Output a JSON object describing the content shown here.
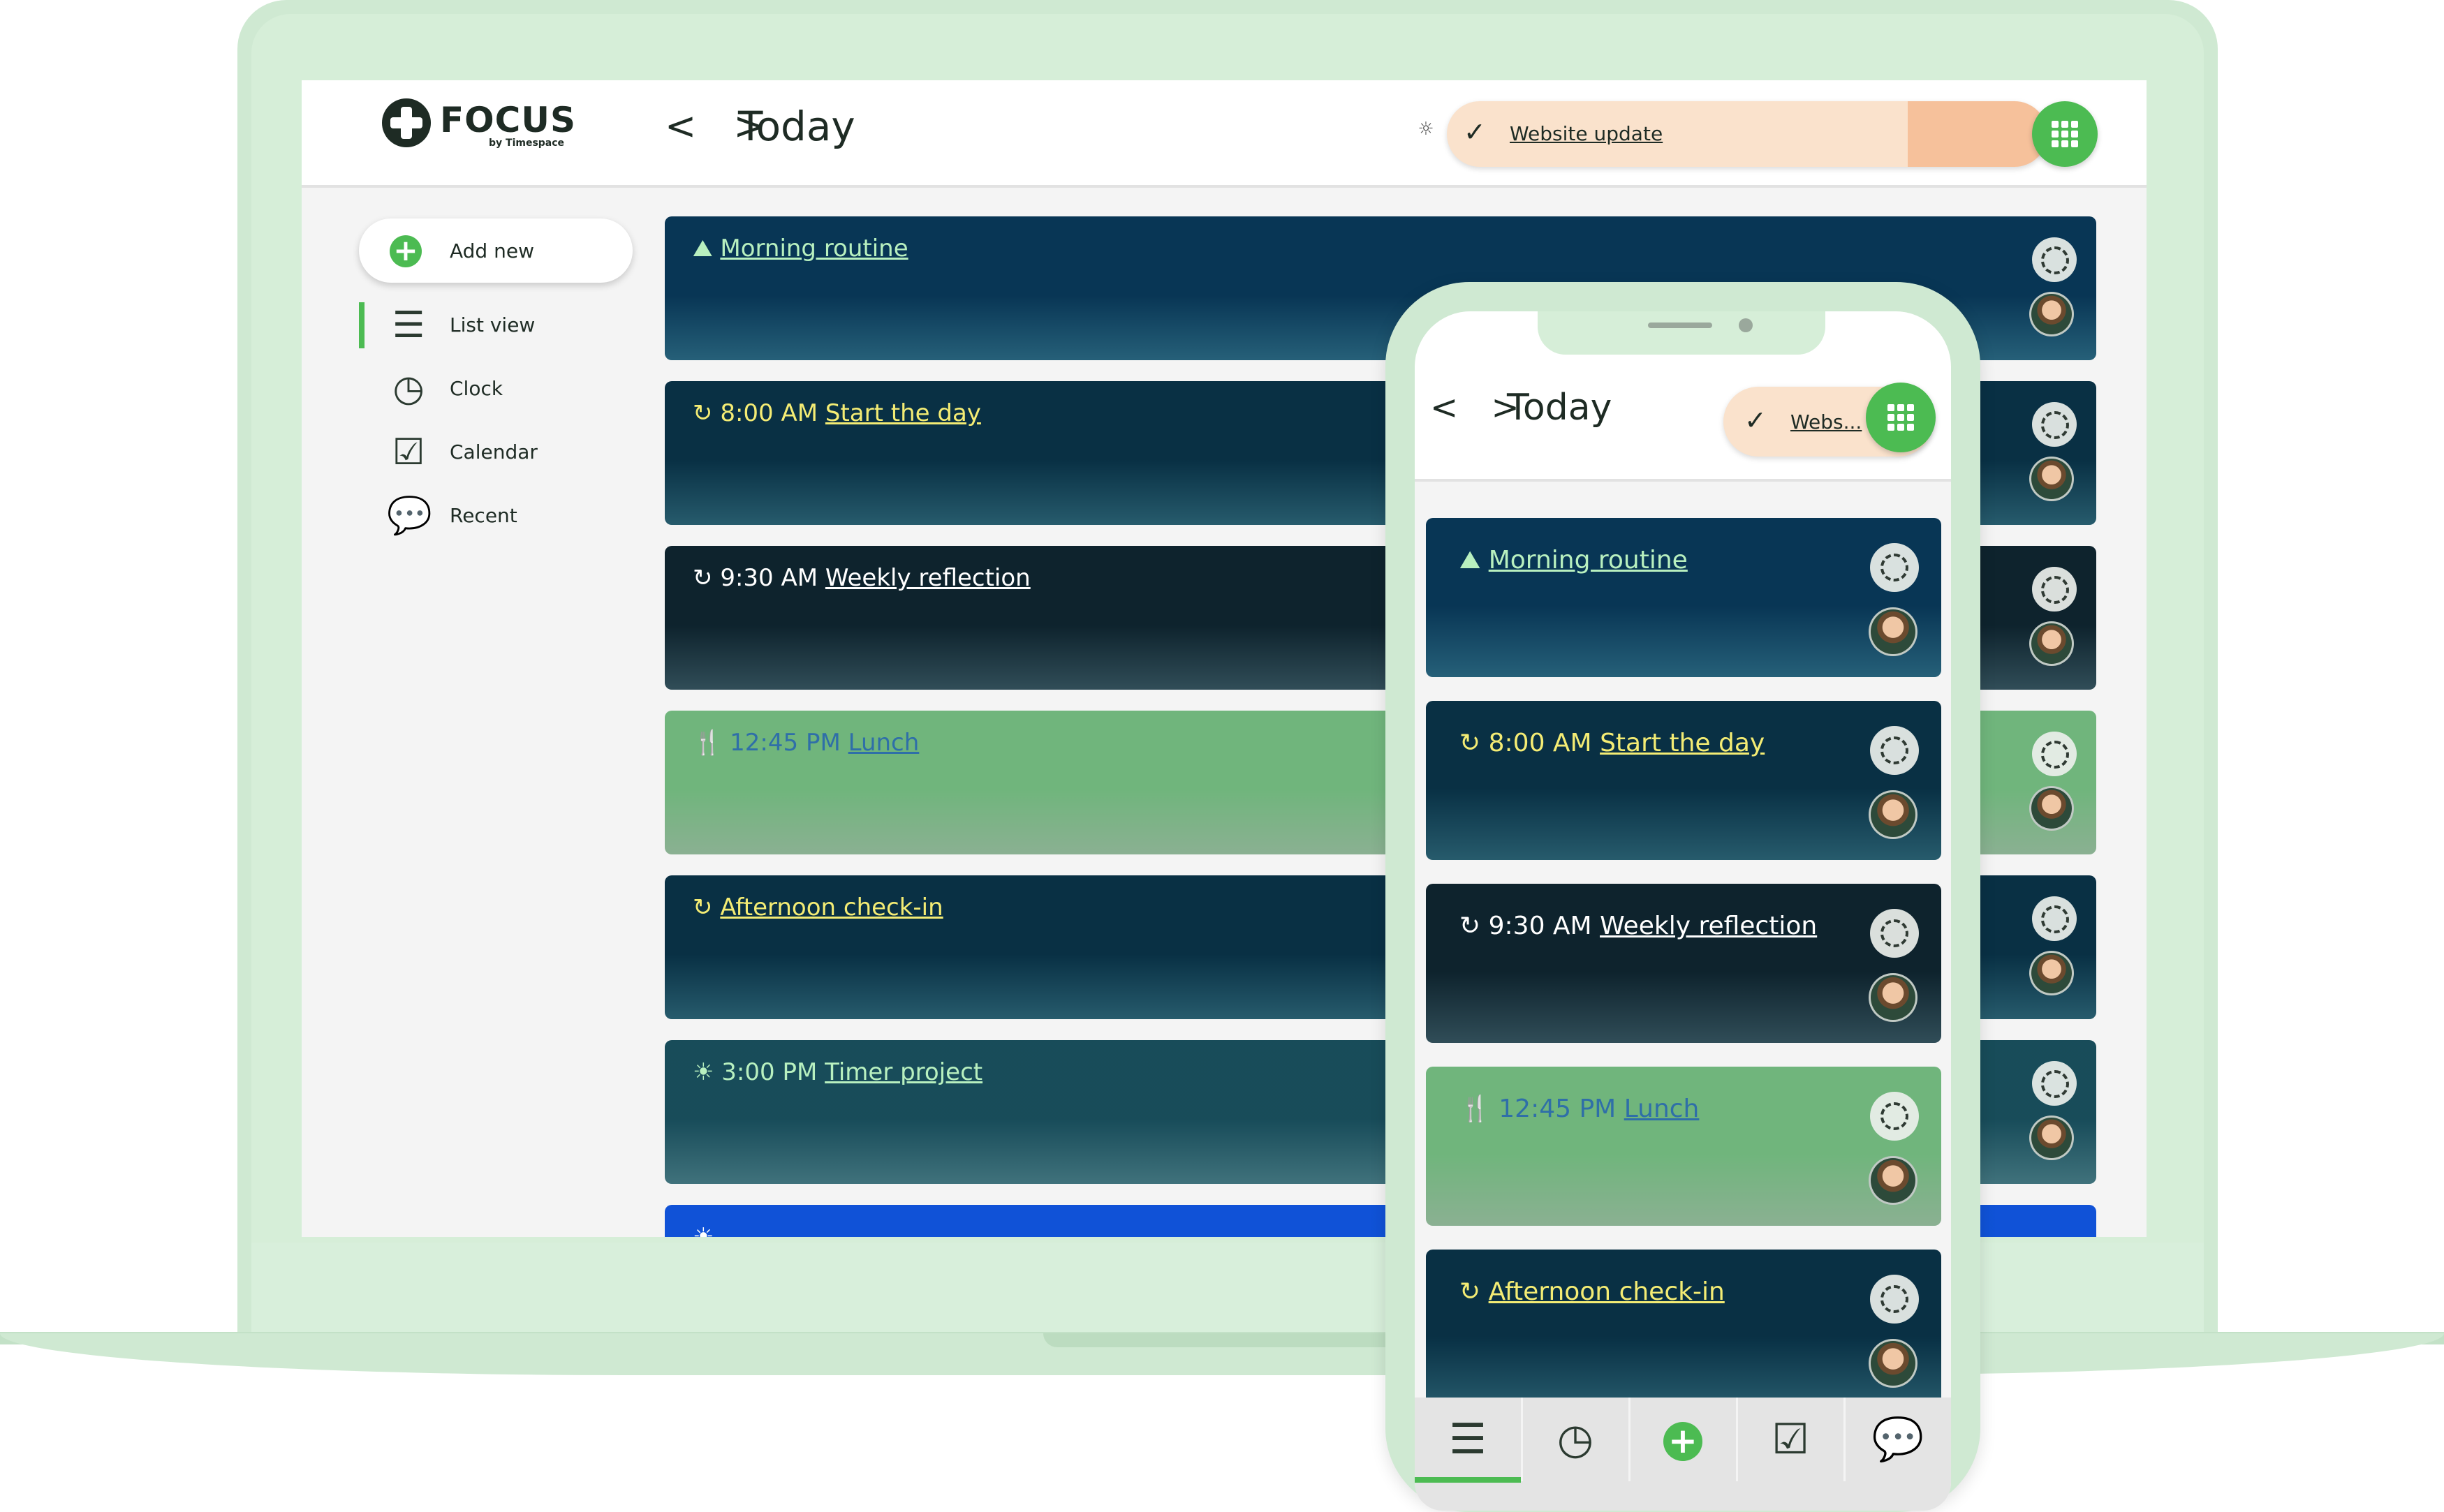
{
  "app": {
    "logo_text": "FOCUS",
    "logo_sub": "by Timespace",
    "nav_arrows": "< >",
    "title": "Today",
    "current_task": "Website update",
    "current_task_short": "Webs..."
  },
  "sidebar": {
    "add_new": "Add new",
    "items": [
      {
        "label": "List view",
        "icon": "list-icon"
      },
      {
        "label": "Clock",
        "icon": "clock-icon"
      },
      {
        "label": "Calendar",
        "icon": "calendar-icon"
      },
      {
        "label": "Recent",
        "icon": "chat-icon"
      }
    ]
  },
  "cards": [
    {
      "icon": "⛰",
      "time": "",
      "title": "Morning routine",
      "color": "#2e7593",
      "text_color": "#b8f0bf"
    },
    {
      "icon": "↻",
      "time": "8:00 AM",
      "title": "Start the day",
      "color": "#2f6f84",
      "text_color": "#f4ec74"
    },
    {
      "icon": "↻",
      "time": "9:30 AM",
      "title": "Weekly reflection",
      "color": "#3b5e6b",
      "text_color": "#ffffff"
    },
    {
      "icon": "🍴",
      "time": "12:45 PM",
      "title": "Lunch",
      "color": "#a9d7b2",
      "text_color": "#2f6fa8"
    },
    {
      "icon": "↻",
      "time": "",
      "title": "Afternoon check-in",
      "color": "#2f6f84",
      "text_color": "#f4ec74"
    },
    {
      "icon": "☀",
      "time": "3:00 PM",
      "title": "Timer project",
      "color": "#4e8b97",
      "text_color": "#b8f0bf"
    },
    {
      "icon": "☀",
      "time": "",
      "title": "",
      "color": "#3f91ea",
      "text_color": "#ffffff"
    }
  ],
  "phone": {
    "cards": [
      {
        "icon": "⛰",
        "time": "",
        "title": "Morning routine",
        "color": "#2e7593",
        "text_color": "#b8f0bf"
      },
      {
        "icon": "↻",
        "time": "8:00 AM",
        "title": "Start the day",
        "color": "#2f6f84",
        "text_color": "#f4ec74"
      },
      {
        "icon": "↻",
        "time": "9:30 AM",
        "title": "Weekly reflection",
        "color": "#3b5e6b",
        "text_color": "#ffffff"
      },
      {
        "icon": "🍴",
        "time": "12:45 PM",
        "title": "Lunch",
        "color": "#a9d7b2",
        "text_color": "#2f6fa8"
      },
      {
        "icon": "↻",
        "time": "",
        "title": "Afternoon check-in",
        "color": "#2f6f84",
        "text_color": "#f4ec74"
      }
    ],
    "tabs": [
      "list-icon",
      "clock-icon",
      "add-icon",
      "calendar-icon",
      "chat-icon"
    ]
  },
  "colors": {
    "accent": "#4cbb52",
    "device": "#cfe9d2",
    "task_pill": "#fae2cc"
  }
}
